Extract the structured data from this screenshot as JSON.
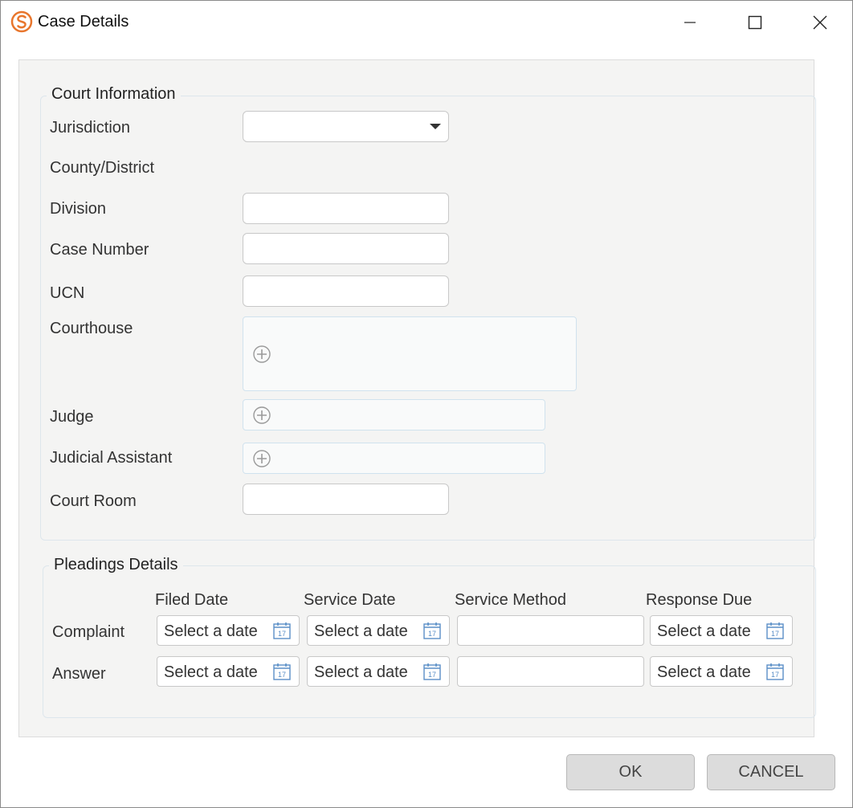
{
  "window": {
    "title": "Case Details"
  },
  "court_information": {
    "legend": "Court Information",
    "labels": {
      "jurisdiction": "Jurisdiction",
      "county_district": "County/District",
      "division": "Division",
      "case_number": "Case Number",
      "ucn": "UCN",
      "courthouse": "Courthouse",
      "judge": "Judge",
      "judicial_assistant": "Judicial Assistant",
      "court_room": "Court Room"
    },
    "values": {
      "jurisdiction": "",
      "division": "",
      "case_number": "",
      "ucn": "",
      "court_room": ""
    }
  },
  "pleadings": {
    "legend": "Pleadings Details",
    "columns": {
      "filed_date": "Filed Date",
      "service_date": "Service Date",
      "service_method": "Service Method",
      "response_due": "Response Due"
    },
    "rows": {
      "complaint": "Complaint",
      "answer": "Answer"
    },
    "date_placeholder": "Select a date",
    "calendar_day": "17"
  },
  "buttons": {
    "ok": "OK",
    "cancel": "CANCEL"
  },
  "colors": {
    "brand": "#e8762d",
    "calendar_icon": "#5b8fc7"
  }
}
